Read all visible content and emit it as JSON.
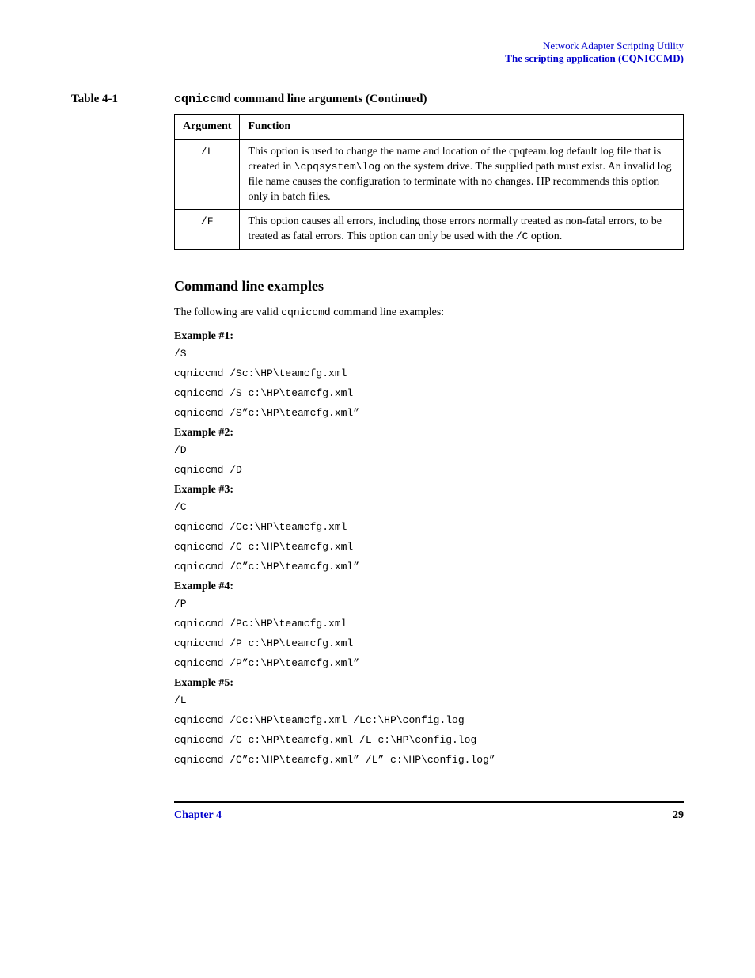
{
  "header": {
    "utility": "Network Adapter Scripting Utility",
    "section": "The scripting application (CQNICCMD)"
  },
  "table_caption": {
    "label": "Table 4-1",
    "prefix_code": "cqniccmd",
    "suffix_text": " command line arguments (Continued)"
  },
  "table": {
    "head": {
      "arg": "Argument",
      "func": "Function"
    },
    "rows": [
      {
        "arg": "/L",
        "func_pre": "This option is used to change the name and location of the cpqteam.log default log file that is created in ",
        "func_code": "\\cpqsystem\\log",
        "func_post": " on the system drive. The supplied path must exist. An invalid log file name causes the configuration to terminate with no changes. HP recommends this option only in batch files."
      },
      {
        "arg": "/F",
        "func_pre": "This option causes all errors, including those errors normally treated as non-fatal errors, to be treated as fatal errors. This option can only be used with the ",
        "func_code": "/C",
        "func_post": " option."
      }
    ]
  },
  "examples": {
    "heading": "Command line examples",
    "intro_pre": "The following are valid ",
    "intro_code": "cqniccmd",
    "intro_post": " command line examples:",
    "items": [
      {
        "title": "Example #1:",
        "lines": [
          "/S",
          "cqniccmd /Sc:\\HP\\teamcfg.xml",
          "cqniccmd /S c:\\HP\\teamcfg.xml",
          "cqniccmd /S”c:\\HP\\teamcfg.xml”"
        ]
      },
      {
        "title": "Example #2:",
        "lines": [
          "/D",
          "cqniccmd /D"
        ]
      },
      {
        "title": "Example #3:",
        "lines": [
          "/C",
          "cqniccmd /Cc:\\HP\\teamcfg.xml",
          "cqniccmd /C c:\\HP\\teamcfg.xml",
          "cqniccmd /C”c:\\HP\\teamcfg.xml”"
        ]
      },
      {
        "title": "Example #4:",
        "lines": [
          "/P",
          "cqniccmd /Pc:\\HP\\teamcfg.xml",
          "cqniccmd /P c:\\HP\\teamcfg.xml",
          "cqniccmd /P”c:\\HP\\teamcfg.xml”"
        ]
      },
      {
        "title": "Example #5:",
        "lines": [
          "/L",
          "cqniccmd /Cc:\\HP\\teamcfg.xml /Lc:\\HP\\config.log",
          "cqniccmd /C c:\\HP\\teamcfg.xml /L c:\\HP\\config.log",
          "cqniccmd /C”c:\\HP\\teamcfg.xml” /L” c:\\HP\\config.log”"
        ]
      }
    ]
  },
  "footer": {
    "chapter": "Chapter 4",
    "page": "29"
  }
}
